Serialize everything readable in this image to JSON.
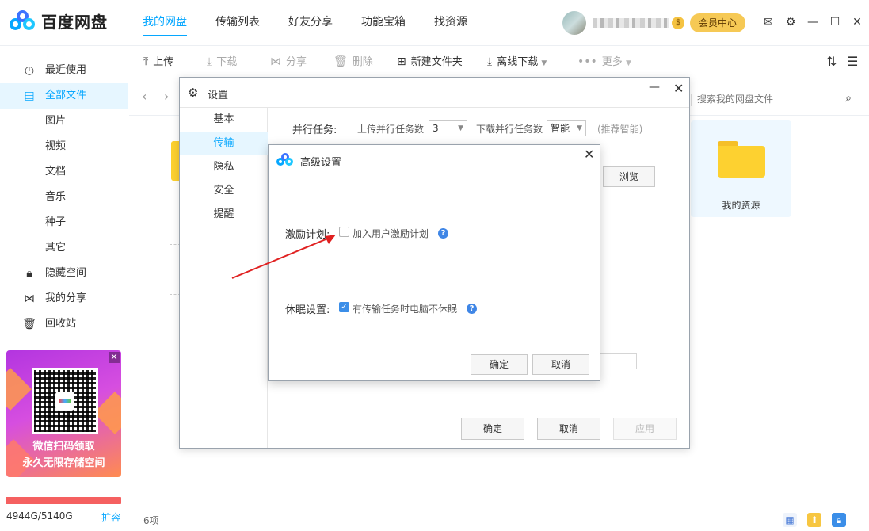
{
  "app": {
    "logo_text": "百度网盘",
    "brand_color": "#06a7ff"
  },
  "nav": {
    "items": [
      {
        "label": "我的网盘",
        "active": true
      },
      {
        "label": "传输列表",
        "active": false
      },
      {
        "label": "好友分享",
        "active": false
      },
      {
        "label": "功能宝箱",
        "active": false
      },
      {
        "label": "找资源",
        "active": false
      }
    ]
  },
  "header": {
    "vip_badge": "$",
    "vip_center": "会员中心",
    "icons": [
      "mail-icon",
      "settings-icon",
      "minimize-icon",
      "maximize-icon",
      "close-icon"
    ]
  },
  "sidebar": {
    "items": [
      {
        "label": "最近使用",
        "icon": "clock-icon"
      },
      {
        "label": "全部文件",
        "icon": "file-icon",
        "active": true
      },
      {
        "label": "图片",
        "sub": true
      },
      {
        "label": "视频",
        "sub": true
      },
      {
        "label": "文档",
        "sub": true
      },
      {
        "label": "音乐",
        "sub": true
      },
      {
        "label": "种子",
        "sub": true
      },
      {
        "label": "其它",
        "sub": true
      },
      {
        "label": "隐藏空间",
        "icon": "lock-icon"
      },
      {
        "label": "我的分享",
        "icon": "share-icon"
      },
      {
        "label": "回收站",
        "icon": "trash-icon"
      }
    ],
    "promo": {
      "line1": "微信扫码领取",
      "line2": "永久无限存储空间"
    },
    "quota": {
      "text": "4944G/5140G",
      "used_fraction": 0.962,
      "expand": "扩容"
    }
  },
  "toolbar": {
    "upload": "上传",
    "download": "下载",
    "share": "分享",
    "delete": "删除",
    "new_folder": "新建文件夹",
    "offline_download": "离线下载",
    "more": "更多"
  },
  "search": {
    "placeholder": "搜索我的网盘文件"
  },
  "files": {
    "visible_card": "我的资源"
  },
  "status": {
    "count": "6项"
  },
  "settings": {
    "title": "设置",
    "tabs": [
      {
        "label": "基本",
        "active": false
      },
      {
        "label": "传输",
        "active": true
      },
      {
        "label": "隐私",
        "active": false
      },
      {
        "label": "安全",
        "active": false
      },
      {
        "label": "提醒",
        "active": false
      }
    ],
    "parallel_label": "并行任务:",
    "upload_parallel_label": "上传并行任务数",
    "upload_parallel_value": "3",
    "download_parallel_label": "下载并行任务数",
    "download_parallel_value": "智能",
    "recommend_text": "(推荐智能)",
    "browse": "浏览",
    "ok": "确定",
    "cancel": "取消",
    "apply": "应用"
  },
  "advanced": {
    "title": "高级设置",
    "incentive_label": "激励计划:",
    "incentive_checkbox": "加入用户激励计划",
    "incentive_checked": false,
    "sleep_label": "休眠设置:",
    "sleep_checkbox": "有传输任务时电脑不休眠",
    "sleep_checked": true,
    "ok": "确定",
    "cancel": "取消"
  }
}
